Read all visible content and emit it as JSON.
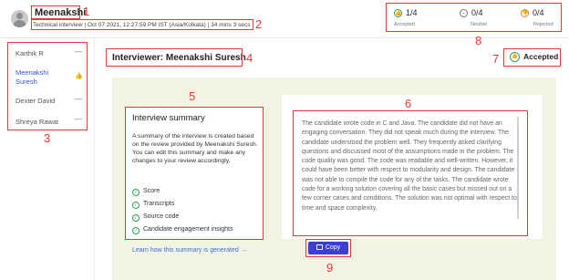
{
  "header": {
    "candidate_name": "Meenakshi",
    "interview_info": "Technical interview | Oct 07 2021, 12:27:59 PM IST (Asia/Kolkata) | 34 mins 3 secs",
    "stats": [
      {
        "value": "1/4",
        "label": "Accepted",
        "icon": "thumbs-up-icon",
        "color": "#2e9e52"
      },
      {
        "value": "0/4",
        "label": "Neutral",
        "icon": "neutral-icon",
        "color": "#777777"
      },
      {
        "value": "0/4",
        "label": "Rejected",
        "icon": "thumbs-down-icon",
        "color": "#e57a3a"
      }
    ]
  },
  "sidebar": {
    "items": [
      {
        "label": "Karthik R",
        "status": "—"
      },
      {
        "label": "Meenakshi Suresh",
        "status": "accepted"
      },
      {
        "label": "Dexter David",
        "status": "—"
      },
      {
        "label": "Shreya Rawat",
        "status": "—"
      }
    ]
  },
  "main": {
    "interviewer_title": "Interviewer: Meenakshi Suresh",
    "decision": "Accepted",
    "summary": {
      "title": "Interview summary",
      "description": "A summary of the interview is created based on the review provided by Meenakshi Suresh. You can edit this summary and make any changes to your review accordingly.",
      "features": [
        "Score",
        "Transcripts",
        "Source code",
        "Candidate engagement insights"
      ],
      "learn_link": "Learn how this summary is generated →"
    },
    "summary_text": "The candidate wrote code in C and Java. The candidate did not have an engaging conversation. They did not speak much during the interview. The candidate understood the problem well. They frequently asked clarifying questions and discussed most of the assumptions made in the problem. The code quality was good. The code was readable and well-written. However, it could have been better with respect to modularity and design. The candidate was not able to compile the code for any of the tasks. The candidate wrote code for a working solution covering all the basic cases but missed out on a few corner cases and conditions. The solution was not optimal with respect to time and space complexity.",
    "copy_label": "Copy"
  },
  "annotations": [
    "1",
    "2",
    "3",
    "4",
    "5",
    "6",
    "7",
    "8",
    "9"
  ],
  "colors": {
    "annotation": "#e53935",
    "accent": "#3b3fd4",
    "panel_bg": "#f1f4e3",
    "accepted": "#2e9e52",
    "link": "#3b6fd6"
  }
}
